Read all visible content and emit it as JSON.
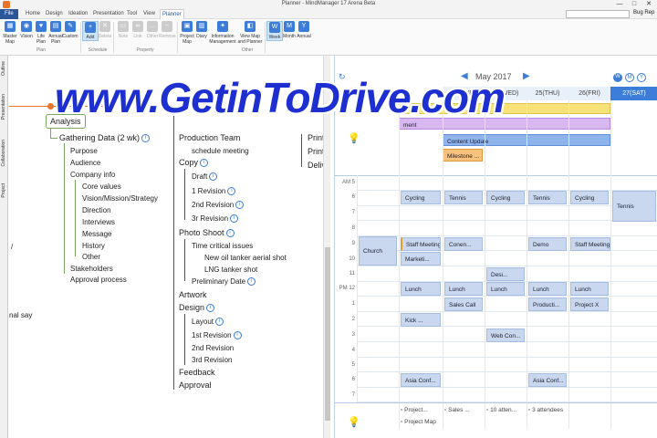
{
  "window": {
    "title": "Planner - MindManager 17 Arena Beta",
    "min": "—",
    "max": "□",
    "close": "✕"
  },
  "tabs": [
    "File",
    "Home",
    "Design",
    "Ideation",
    "Presentation",
    "Tool",
    "View",
    "Planner"
  ],
  "ribbon": {
    "buttons": [
      {
        "label": "Master Map",
        "icon": "map-icon"
      },
      {
        "label": "Vision",
        "icon": "vision-icon"
      },
      {
        "label": "Life Plan",
        "icon": "life-plan-icon"
      },
      {
        "label": "Annual Plan",
        "icon": "annual-plan-icon"
      },
      {
        "label": "Custom",
        "icon": "custom-icon"
      },
      {
        "label": "Add",
        "icon": "add-icon"
      },
      {
        "label": "Delete",
        "icon": "delete-icon"
      },
      {
        "label": "Note",
        "icon": "note-icon"
      },
      {
        "label": "Link",
        "icon": "link-icon"
      },
      {
        "label": "Other",
        "icon": "other-icon"
      },
      {
        "label": "Remove",
        "icon": "remove-icon"
      },
      {
        "label": "Project Map",
        "icon": "project-map-icon"
      },
      {
        "label": "Diary",
        "icon": "diary-icon"
      },
      {
        "label": "Information Management",
        "icon": "info-mgmt-icon"
      },
      {
        "label": "View Map and Planner",
        "icon": "view-map-icon"
      },
      {
        "label": "Week",
        "icon": "week-icon"
      },
      {
        "label": "Month",
        "icon": "month-icon"
      },
      {
        "label": "Annual",
        "icon": "annual-icon"
      }
    ],
    "groups": [
      "Plan",
      "Schedule",
      "Property",
      "Other"
    ]
  },
  "sidebar": [
    "Outline",
    "Presentation",
    "Collaboration",
    "Project"
  ],
  "map": {
    "root": "Analysis",
    "gathering": "Gathering Data (2 wk)",
    "gathering_items": [
      "Purpose",
      "Audience",
      "Company info",
      "Core values",
      "Vision/Mission/Strategy",
      "Direction",
      "Interviews",
      "Message",
      "History",
      "Other",
      "Stakeholders",
      "Approval process"
    ],
    "production": "Production Team",
    "schedule_meeting": "schedule meeting",
    "copy": "Copy",
    "copy_items": [
      "Draft",
      "1 Revision",
      "2nd Revision",
      "3r Revision"
    ],
    "photo": "Photo Shoot",
    "time_critical": "Time critical issues",
    "photo_items": [
      "New oil tanker aerial shot",
      "LNG tanker shot"
    ],
    "prelim": "Preliminary Date",
    "artwork": "Artwork",
    "design": "Design",
    "design_items": [
      "Layout",
      "1st Revision",
      "2nd Revision",
      "3rd Revision"
    ],
    "feedback": "Feedback",
    "approval": "Approval",
    "right_items": [
      "Print",
      "Print",
      "Deliv"
    ],
    "left_edge": [
      "/",
      "nal say"
    ]
  },
  "calendar": {
    "month": "May  2017",
    "days": [
      "23(TUE)",
      "24(WED)",
      "25(THU)",
      "26(FRI)",
      "27(SAT)"
    ],
    "view_buttons": [
      "W",
      "M",
      "Y"
    ],
    "allday": {
      "ment": "ment",
      "content_update": "Content Update",
      "milestone": "Milestone ..."
    },
    "hours": [
      "AM 5",
      "6",
      "7",
      "8",
      "9",
      "10",
      "11",
      "PM 12",
      "1",
      "2",
      "3",
      "4",
      "5",
      "6",
      "7"
    ],
    "events": {
      "church": "Church",
      "cycling1": "Cycling",
      "tennis1": "Tennis",
      "cycling2": "Cycling",
      "tennis2": "Tennis",
      "cycling3": "Cycling",
      "tennis3": "Tennis",
      "staff1": "Staff Meeting",
      "conen": "Conen...",
      "demo": "Demo",
      "staff2": "Staff Meeting",
      "market": "Marketi...",
      "desi": "Desi...",
      "lunch1": "Lunch",
      "lunch2": "Lunch",
      "lunch3": "Lunch",
      "lunch4": "Lunch",
      "lunch5": "Lunch",
      "sales": "Sales Call",
      "producti": "Producti...",
      "projx": "Project X",
      "kick": "Kick ...",
      "webcon": "Web Con...",
      "asia1": "Asia Conf...",
      "asia2": "Asia Conf..."
    },
    "footer": [
      "Project...",
      "Sales ...",
      "10 atten...",
      "3 attendees",
      "Project Map"
    ]
  },
  "watermark": "www.GetinToDrive.com",
  "colors": {
    "accent": "#2b579a",
    "calendar_blue": "#3b7dd8",
    "yellow": "#f7e27a",
    "purple": "#d9b8f2",
    "orange": "#f9c27a"
  }
}
